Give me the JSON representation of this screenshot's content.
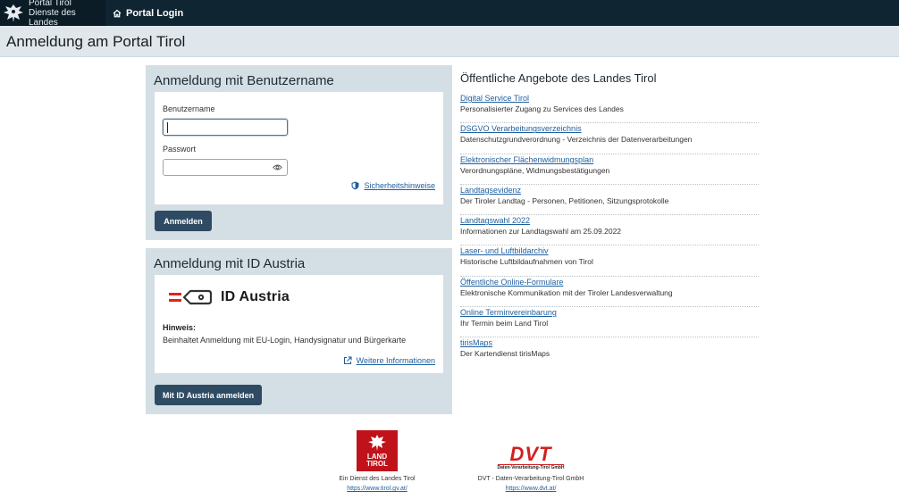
{
  "topbar": {
    "brand_line1": "Portal Tirol",
    "brand_line2": "Dienste des Landes",
    "home_label": "Portal Login"
  },
  "page": {
    "title": "Anmeldung am Portal Tirol"
  },
  "login": {
    "title": "Anmeldung mit Benutzername",
    "username_label": "Benutzername",
    "username_value": "",
    "password_label": "Passwort",
    "password_value": "",
    "security_link": "Sicherheitshinweise",
    "submit_label": "Anmelden"
  },
  "id_austria": {
    "title": "Anmeldung mit ID Austria",
    "logo_text": "ID Austria",
    "hint_title": "Hinweis:",
    "hint_text": "Beinhaltet Anmeldung mit EU-Login, Handysignatur und Bürgerkarte",
    "more_link": "Weitere Informationen",
    "submit_label": "Mit ID Austria anmelden"
  },
  "offers": {
    "title": "Öffentliche Angebote des Landes Tirol",
    "items": [
      {
        "link": "Digital Service Tirol",
        "desc": "Personalisierter Zugang zu Services des Landes"
      },
      {
        "link": "DSGVO Verarbeitungsverzeichnis",
        "desc": "Datenschutzgrundverordnung - Verzeichnis der Datenverarbeitungen"
      },
      {
        "link": "Elektronischer Flächenwidmungsplan",
        "desc": "Verordnungspläne, Widmungsbestätigungen"
      },
      {
        "link": "Landtagsevidenz",
        "desc": "Der Tiroler Landtag - Personen, Petitionen, Sitzungsprotokolle"
      },
      {
        "link": "Landtagswahl 2022",
        "desc": "Informationen zur Landtagswahl am 25.09.2022"
      },
      {
        "link": "Laser- und Luftbildarchiv",
        "desc": "Historische Luftbildaufnahmen von Tirol"
      },
      {
        "link": "Öffentliche Online-Formulare",
        "desc": "Elektronische Kommunikation mit der Tiroler Landesverwaltung"
      },
      {
        "link": "Online Terminvereinbarung",
        "desc": "Ihr Termin beim Land Tirol"
      },
      {
        "link": "tirisMaps",
        "desc": "Der Kartendienst tirisMaps"
      }
    ]
  },
  "footer": {
    "land": {
      "logo_line1": "LAND",
      "logo_line2": "TIROL",
      "text": "Ein Dienst des Landes Tirol",
      "url": "https://www.tirol.gv.at/"
    },
    "dvt": {
      "logo_text": "DVT",
      "logo_sub": "Daten-Verarbeitung-Tirol GmbH",
      "text": "DVT - Daten-Verarbeitung-Tirol GmbH",
      "url": "https://www.dvt.at/"
    }
  },
  "colors": {
    "topbar": "#0f2532",
    "card_bg": "#d4dfe5",
    "button": "#2e4b63",
    "link": "#1f5f9e",
    "land_red": "#c0121a",
    "dvt_red": "#d21f1f"
  },
  "icons": [
    "eagle-icon",
    "home-icon",
    "eye-icon",
    "shield-icon",
    "id-austria-key-icon",
    "external-link-icon"
  ]
}
